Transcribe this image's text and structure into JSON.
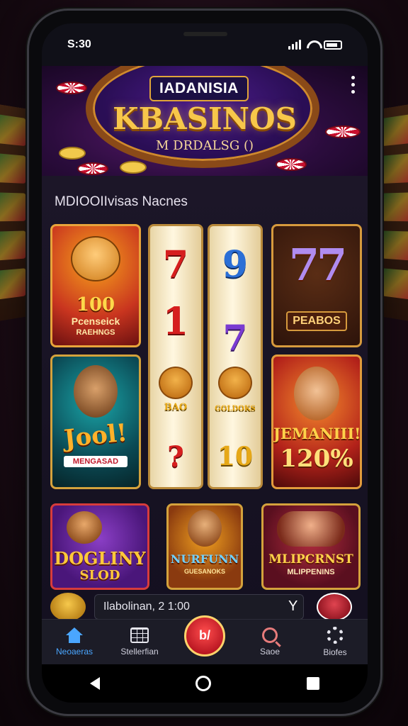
{
  "status_bar": {
    "time": "S:30"
  },
  "banner": {
    "brand_tag": "IADANISIA",
    "title": "KBASINOS",
    "subtitle": "M DRDALSG ()"
  },
  "section": {
    "title": "MDIOOIIvisas Nacnes"
  },
  "tiles": {
    "t1": {
      "line1": "100",
      "line2": "Pcenseick",
      "line3": "RAEHNGS"
    },
    "t2": {
      "symbols": "77",
      "label": "PEABOS"
    },
    "t3": {
      "title": "Jool!",
      "label": "MENGASAD"
    },
    "t4": {
      "title": "JEMANIII!",
      "amount": "120%"
    },
    "t5": {
      "title": "DOGLINY",
      "subtitle": "SLOD"
    },
    "t6": {
      "title": "NURFUNN",
      "subtitle": "GUESANOKS"
    },
    "t7": {
      "title": "MLIPCRNST",
      "subtitle": "MLIPPENINS"
    }
  },
  "reels": {
    "r1": [
      "7",
      "1",
      "BAO",
      "?"
    ],
    "r2": [
      "9",
      "7",
      "GOLDOKS",
      "10"
    ]
  },
  "search": {
    "value": "Ilabolinan, 2 1:00",
    "mark": "Y"
  },
  "bottom_nav": {
    "items": [
      {
        "label": "Neoaeras",
        "icon": "home-icon",
        "active": true
      },
      {
        "label": "Stellerfian",
        "icon": "calendar-grid-icon",
        "active": false
      },
      {
        "label": "b/",
        "icon": "spin-button-icon",
        "active": false
      },
      {
        "label": "Saoe",
        "icon": "search-icon",
        "active": false
      },
      {
        "label": "Biofes",
        "icon": "gear-icon",
        "active": false
      }
    ]
  },
  "colors": {
    "accent": "#4aa6ff",
    "gold": "#f7c74a",
    "chip_red": "#c8102e"
  }
}
